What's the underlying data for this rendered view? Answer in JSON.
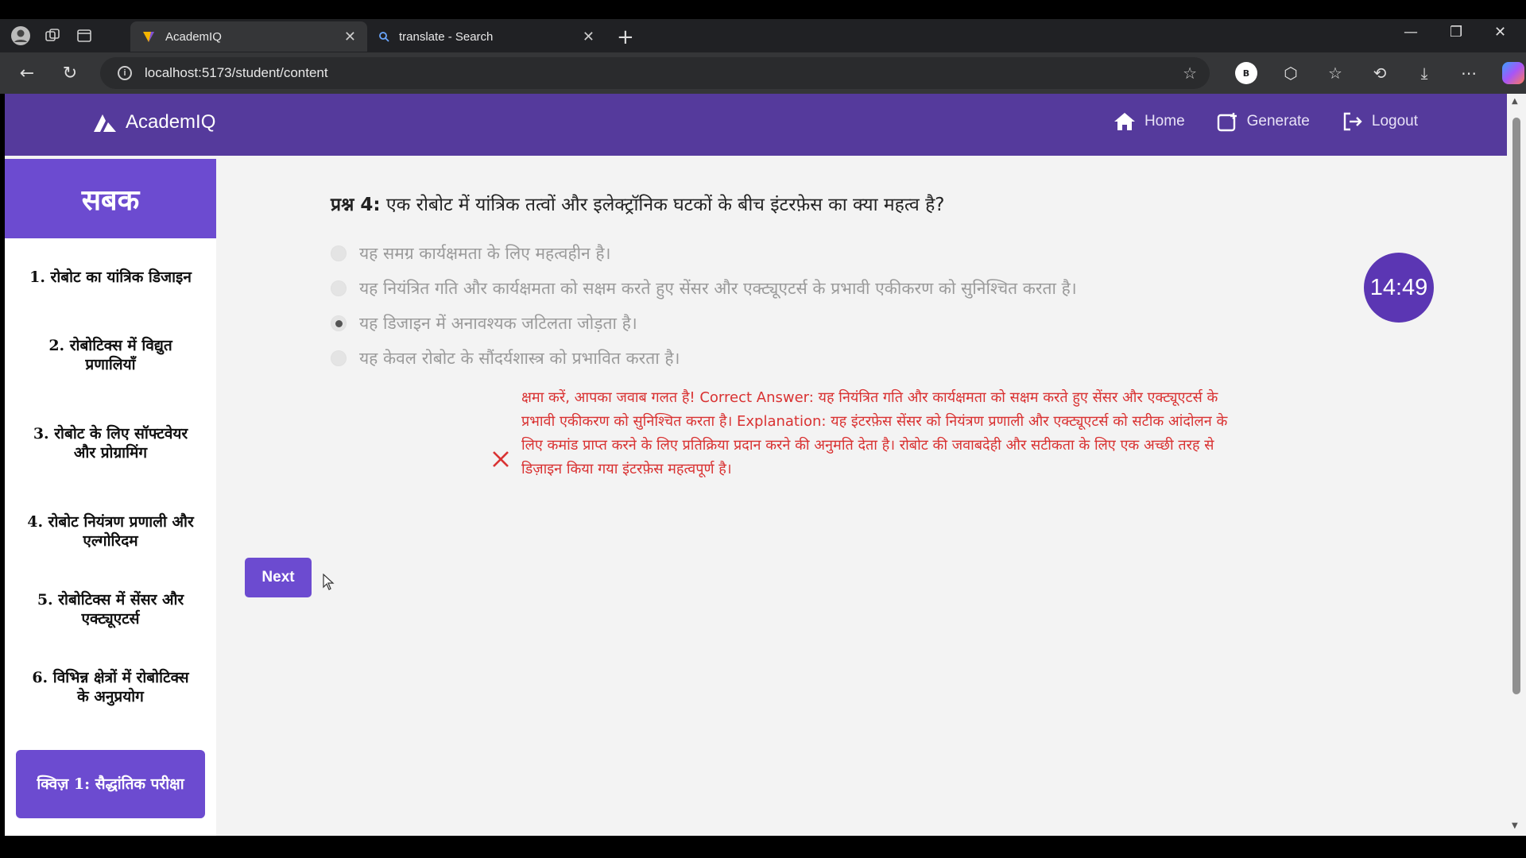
{
  "browser": {
    "tabs": [
      {
        "title": "AcademIQ",
        "active": true
      },
      {
        "title": "translate - Search",
        "active": false
      }
    ],
    "url": "localhost:5173/student/content",
    "profile_initial": "B"
  },
  "app": {
    "brand": "AcademIQ",
    "nav": [
      {
        "label": "Home",
        "icon": "home-icon"
      },
      {
        "label": "Generate",
        "icon": "generate-icon"
      },
      {
        "label": "Logout",
        "icon": "logout-icon"
      }
    ]
  },
  "sidebar": {
    "title": "सबक",
    "items": [
      {
        "label": "1. रोबोट का यांत्रिक डिजाइन"
      },
      {
        "label": "2. रोबोटिक्स में विद्युत प्रणालियाँ"
      },
      {
        "label": "3. रोबोट के लिए सॉफ्टवेयर और प्रोग्रामिंग"
      },
      {
        "label": "4. रोबोट नियंत्रण प्रणाली और एल्गोरिदम"
      },
      {
        "label": "5. रोबोटिक्स में सेंसर और एक्ट्यूएटर्स"
      },
      {
        "label": "6. विभिन्न क्षेत्रों में रोबोटिक्स के अनुप्रयोग"
      }
    ],
    "active_item": "क्विज़ 1: सैद्धांतिक परीक्षा"
  },
  "quiz": {
    "question_number": "प्रश्न 4:",
    "question_text": "एक रोबोट में यांत्रिक तत्वों और इलेक्ट्रॉनिक घटकों के बीच इंटरफ़ेस का क्या महत्व है?",
    "options": [
      {
        "text": "यह समग्र कार्यक्षमता के लिए महत्वहीन है।",
        "selected": false
      },
      {
        "text": "यह नियंत्रित गति और कार्यक्षमता को सक्षम करते हुए सेंसर और एक्ट्यूएटर्स के प्रभावी एकीकरण को सुनिश्चित करता है।",
        "selected": false
      },
      {
        "text": "यह डिजाइन में अनावश्यक जटिलता जोड़ता है।",
        "selected": true
      },
      {
        "text": "यह केवल रोबोट के सौंदर्यशास्त्र को प्रभावित करता है।",
        "selected": false
      }
    ],
    "feedback": "क्षमा करें, आपका जवाब गलत है! Correct Answer: यह नियंत्रित गति और कार्यक्षमता को सक्षम करते हुए सेंसर और एक्ट्यूएटर्स के प्रभावी एकीकरण को सुनिश्चित करता है। Explanation: यह इंटरफ़ेस सेंसर को नियंत्रण प्रणाली और एक्ट्यूएटर्स को सटीक आंदोलन के लिए कमांड प्राप्त करने के लिए प्रतिक्रिया प्रदान करने की अनुमति देता है। रोबोट की जवाबदेही और सटीकता के लिए एक अच्छी तरह से डिज़ाइन किया गया इंटरफ़ेस महत्वपूर्ण है।",
    "timer": "14:49",
    "next_label": "Next"
  },
  "colors": {
    "primary": "#6c4bd0",
    "nav": "#553a9c",
    "error": "#d93232"
  }
}
